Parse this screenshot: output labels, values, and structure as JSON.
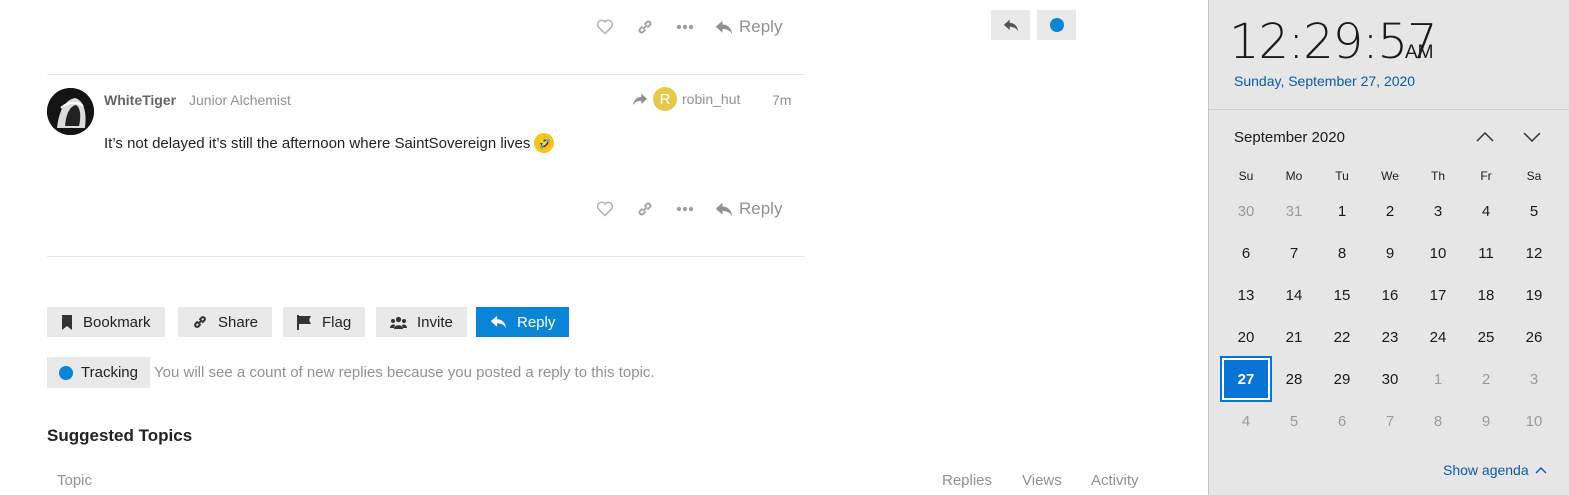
{
  "post_top": {
    "reply_label": "Reply"
  },
  "post": {
    "username": "WhiteTiger",
    "user_title": "Junior Alchemist",
    "reply_to_avatar_letter": "R",
    "reply_to_user": "robin_hut",
    "age": "7m",
    "body": "It’s not delayed it’s still the afternoon where SaintSovereign lives",
    "emoji": "rolling-on-floor-laughing",
    "reply_label": "Reply"
  },
  "footer_buttons": {
    "bookmark": "Bookmark",
    "share": "Share",
    "flag": "Flag",
    "invite": "Invite",
    "reply": "Reply"
  },
  "tracking": {
    "label": "Tracking",
    "description": "You will see a count of new replies because you posted a reply to this topic."
  },
  "suggested": {
    "title": "Suggested Topics",
    "columns": [
      "Topic",
      "Replies",
      "Views",
      "Activity"
    ]
  },
  "colors": {
    "accent": "#0a84d6",
    "calendar_today": "#0a74d6",
    "link": "#0c5aa6"
  },
  "clock": {
    "time": "12:29:57",
    "ampm": "AM",
    "date": "Sunday, September 27, 2020",
    "month_label": "September 2020",
    "weekdays": [
      "Su",
      "Mo",
      "Tu",
      "We",
      "Th",
      "Fr",
      "Sa"
    ],
    "days": [
      {
        "d": "30",
        "m": true
      },
      {
        "d": "31",
        "m": true
      },
      {
        "d": "1"
      },
      {
        "d": "2"
      },
      {
        "d": "3"
      },
      {
        "d": "4"
      },
      {
        "d": "5"
      },
      {
        "d": "6"
      },
      {
        "d": "7"
      },
      {
        "d": "8"
      },
      {
        "d": "9"
      },
      {
        "d": "10"
      },
      {
        "d": "11"
      },
      {
        "d": "12"
      },
      {
        "d": "13"
      },
      {
        "d": "14"
      },
      {
        "d": "15"
      },
      {
        "d": "16"
      },
      {
        "d": "17"
      },
      {
        "d": "18"
      },
      {
        "d": "19"
      },
      {
        "d": "20"
      },
      {
        "d": "21"
      },
      {
        "d": "22"
      },
      {
        "d": "23"
      },
      {
        "d": "24"
      },
      {
        "d": "25"
      },
      {
        "d": "26"
      },
      {
        "d": "27",
        "t": true
      },
      {
        "d": "28"
      },
      {
        "d": "29"
      },
      {
        "d": "30"
      },
      {
        "d": "1",
        "m": true
      },
      {
        "d": "2",
        "m": true
      },
      {
        "d": "3",
        "m": true
      },
      {
        "d": "4",
        "m": true
      },
      {
        "d": "5",
        "m": true
      },
      {
        "d": "6",
        "m": true
      },
      {
        "d": "7",
        "m": true
      },
      {
        "d": "8",
        "m": true
      },
      {
        "d": "9",
        "m": true
      },
      {
        "d": "10",
        "m": true
      }
    ],
    "agenda_label": "Show agenda"
  }
}
